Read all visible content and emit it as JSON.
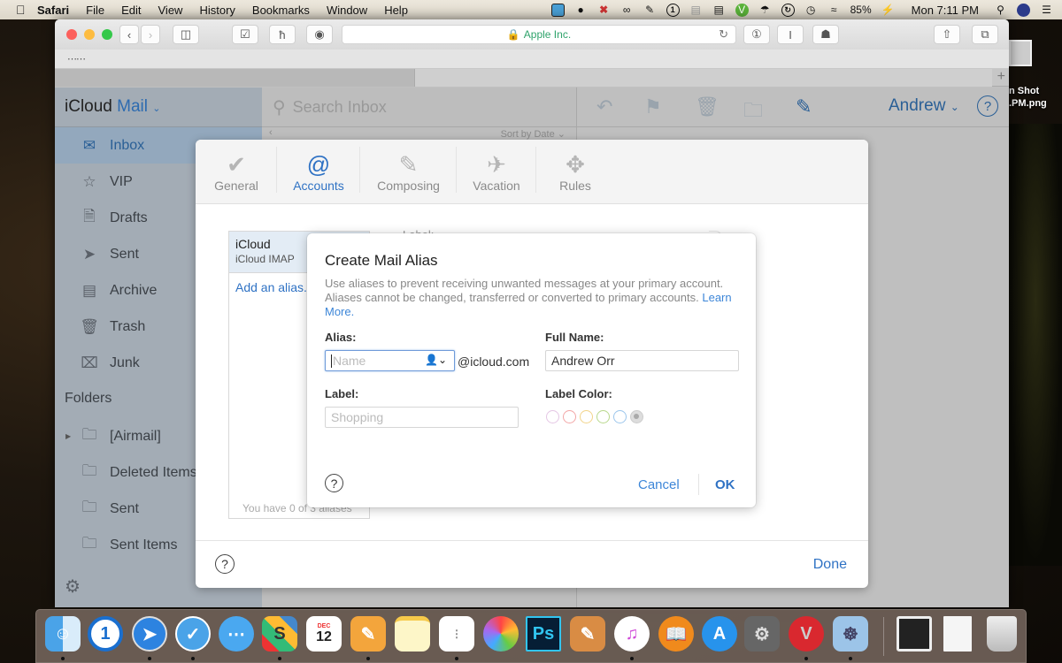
{
  "menubar": {
    "apple": "",
    "items": [
      "Safari",
      "File",
      "Edit",
      "View",
      "History",
      "Bookmarks",
      "Window",
      "Help"
    ],
    "status_icons": [
      "system-preferences-icon",
      "moon-icon",
      "x-icon",
      "creative-cloud-icon",
      "pen-icon",
      "1password-icon",
      "network-icon",
      "layout-icon",
      "vivaldi-icon",
      "umbrella-icon",
      "sync-icon",
      "time-machine-icon",
      "wifi-icon"
    ],
    "battery": "85%",
    "clock": "Mon 7:11 PM"
  },
  "browser": {
    "url_label": "Apple Inc.",
    "secure": true
  },
  "icloud": {
    "brand_prefix": "iCloud",
    "brand_app": "Mail",
    "mailboxes": [
      {
        "label": "Inbox",
        "icon": "inbox-icon",
        "selected": true
      },
      {
        "label": "VIP",
        "icon": "star-icon"
      },
      {
        "label": "Drafts",
        "icon": "document-icon"
      },
      {
        "label": "Sent",
        "icon": "paper-plane-icon"
      },
      {
        "label": "Archive",
        "icon": "archive-box-icon"
      },
      {
        "label": "Trash",
        "icon": "trash-icon"
      },
      {
        "label": "Junk",
        "icon": "junk-box-icon"
      }
    ],
    "folders_heading": "Folders",
    "folders": [
      {
        "label": "[Airmail]",
        "expandable": true
      },
      {
        "label": "Deleted Items"
      },
      {
        "label": "Sent"
      },
      {
        "label": "Sent Items"
      }
    ],
    "search_placeholder": "Search Inbox",
    "sort_label": "Sort by Date",
    "user_name": "Andrew"
  },
  "preferences": {
    "tabs": [
      {
        "label": "General",
        "icon": "checkmark-circle-icon"
      },
      {
        "label": "Accounts",
        "icon": "at-sign-icon",
        "active": true
      },
      {
        "label": "Composing",
        "icon": "compose-icon"
      },
      {
        "label": "Vacation",
        "icon": "airplane-icon"
      },
      {
        "label": "Rules",
        "icon": "arrows-icon"
      }
    ],
    "account": {
      "name": "iCloud",
      "type": "iCloud IMAP"
    },
    "add_alias_link": "Add an alias...",
    "alias_count": "You have 0 of 3 aliases",
    "behind_label": "Label:",
    "done": "Done"
  },
  "alias_dialog": {
    "title": "Create Mail Alias",
    "description": "Use aliases to prevent receiving unwanted messages at your primary account. Aliases cannot be changed, transferred or converted to primary accounts.",
    "learn_more": "Learn More.",
    "alias_label": "Alias:",
    "alias_placeholder": "Name",
    "alias_value": "",
    "domain": "@icloud.com",
    "full_name_label": "Full Name:",
    "full_name_value": "Andrew Orr",
    "label_label": "Label:",
    "label_placeholder": "Shopping",
    "label_color_label": "Label Color:",
    "label_colors": [
      "#e4c6e4",
      "#f2a6a6",
      "#f2d48a",
      "#b8d88c",
      "#9cc6ec",
      "#cccccc"
    ],
    "selected_color_index": 5,
    "cancel": "Cancel",
    "ok": "OK"
  },
  "desktop": {
    "file_label_line1": "n Shot",
    "file_label_line2": ".PM.png"
  },
  "dock": {
    "apps": [
      "Finder",
      "1Password",
      "Safari",
      "Airmail",
      "Messages",
      "Slack",
      "Calendar",
      "Pages",
      "Notes",
      "Reminders",
      "Photos",
      "Photoshop",
      "Pixelmator",
      "iTunes",
      "iBooks",
      "App Store",
      "System Preferences",
      "Vivaldi",
      "Preview",
      "Downloads",
      "Document",
      "Trash"
    ],
    "calendar_month": "DEC",
    "calendar_day": "12"
  }
}
